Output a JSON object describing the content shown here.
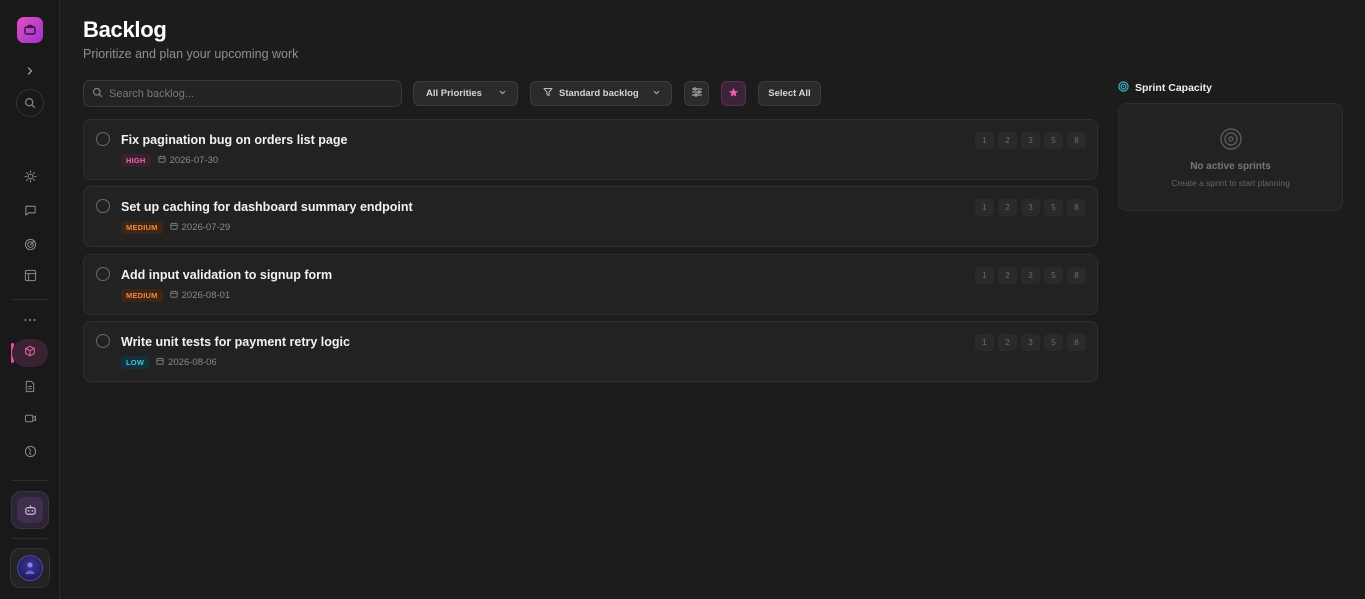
{
  "page": {
    "title": "Backlog",
    "subtitle": "Prioritize and plan your upcoming work"
  },
  "toolbar": {
    "search_placeholder": "Search backlog...",
    "priority_filter": "All Priorities",
    "view_filter": "Standard backlog",
    "select_all": "Select All"
  },
  "sidebar": {
    "icons": [
      "logo-icon",
      "chevron-right-icon",
      "search-icon",
      "sun-icon",
      "chat-icon",
      "radar-icon",
      "layout-icon",
      "more-icon",
      "cube-icon",
      "document-icon",
      "video-icon",
      "globe-icon",
      "robot-icon",
      "avatar"
    ],
    "active_color": "#e0509f"
  },
  "items": [
    {
      "title": "Fix pagination bug on orders list page",
      "priority": "HIGH",
      "date": "2026-07-30"
    },
    {
      "title": "Set up caching for dashboard summary endpoint",
      "priority": "MEDIUM",
      "date": "2026-07-29"
    },
    {
      "title": "Add input validation to signup form",
      "priority": "MEDIUM",
      "date": "2026-08-01"
    },
    {
      "title": "Write unit tests for payment retry logic",
      "priority": "LOW",
      "date": "2026-08-06"
    }
  ],
  "story_points": [
    "1",
    "2",
    "3",
    "5",
    "8"
  ],
  "sprint_capacity": {
    "heading": "Sprint Capacity",
    "empty_title": "No active sprints",
    "empty_subtitle": "Create a sprint to start planning"
  },
  "colors": {
    "high": "#e768b4",
    "medium": "#f0883a",
    "low": "#4fc2dc",
    "accent": "#e052c0"
  }
}
